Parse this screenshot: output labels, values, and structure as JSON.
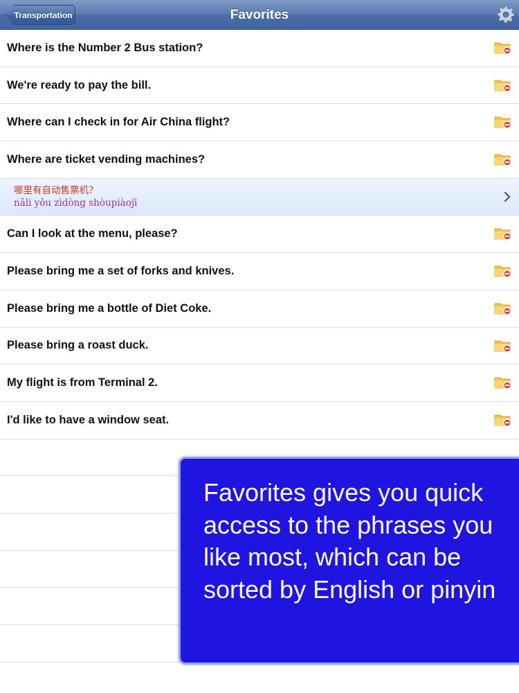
{
  "navbar": {
    "back_label": "Transportation",
    "title": "Favorites",
    "settings_icon": "gear-icon"
  },
  "favorites": [
    {
      "english": "Where is the Number 2 Bus station?"
    },
    {
      "english": "We're ready to pay the bill."
    },
    {
      "english": "Where can I check in for Air China flight?"
    },
    {
      "english": "Where are ticket vending machines?"
    },
    {
      "chinese": "哪里有自动售票机?",
      "pinyin": "nǎli yǒu zìdòng shòupiàojī",
      "selected": true
    },
    {
      "english": "Can I look at the menu, please?"
    },
    {
      "english": "Please bring me a set of forks and knives."
    },
    {
      "english": "Please bring me a bottle of Diet Coke."
    },
    {
      "english": "Please bring a roast duck."
    },
    {
      "english": "My flight is from Terminal 2."
    },
    {
      "english": "I'd like to have a window seat."
    }
  ],
  "row_icon": "folder-remove-icon",
  "overlay": {
    "text": "Favorites gives you quick access to the phrases you like most, which can be sorted by English or pinyin"
  },
  "colors": {
    "overlay_bg": "#1f14e0",
    "chinese_text": "#c0392b",
    "pinyin_text": "#9b2fae"
  }
}
